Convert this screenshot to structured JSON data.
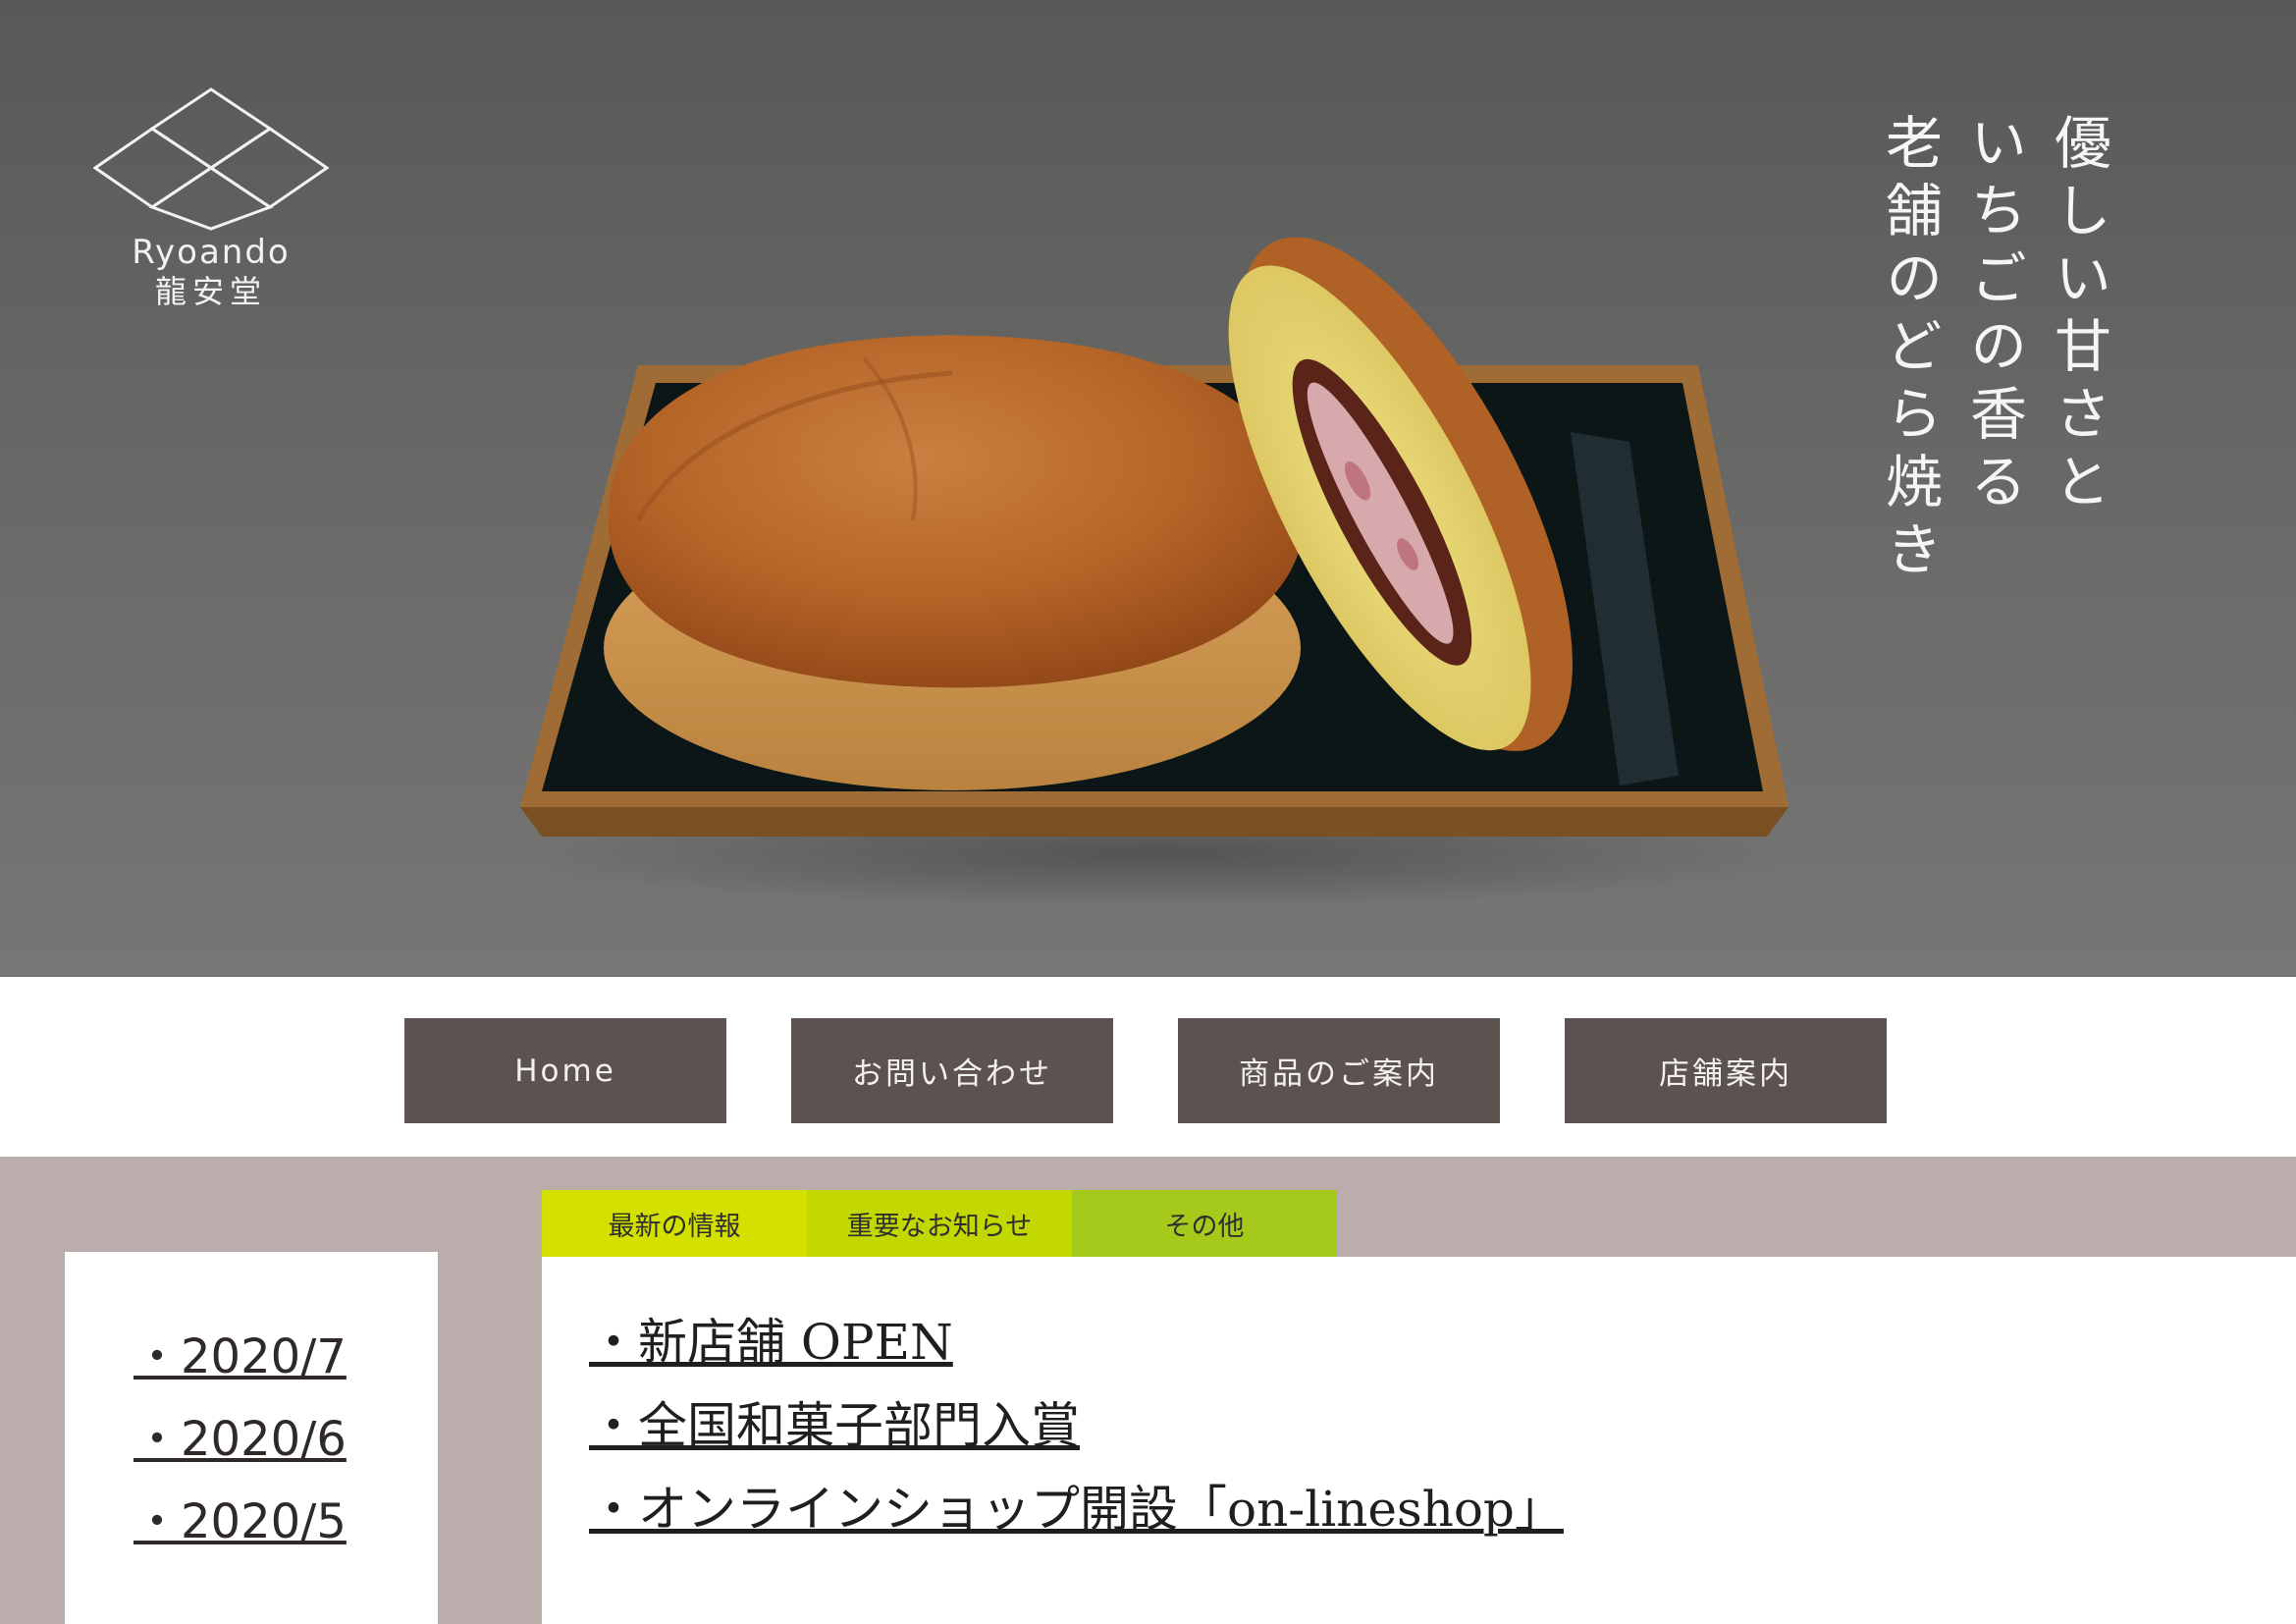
{
  "brand": {
    "name_en": "Ryoando",
    "name_ja": "龍安堂"
  },
  "hero": {
    "tagline_lines": [
      "優しい甘さと",
      "いちごの香る",
      "老舗のどら焼き"
    ],
    "image": "strawberry-dorayaki-on-tray"
  },
  "nav": {
    "items": [
      {
        "label": "Home"
      },
      {
        "label": "お問い合わせ"
      },
      {
        "label": "商品のご案内"
      },
      {
        "label": "店舗案内"
      }
    ]
  },
  "sidebar": {
    "archives": [
      "・2020/7",
      "・2020/6",
      "・2020/5"
    ]
  },
  "tabs": [
    {
      "label": "最新の情報",
      "color": "#d4e000"
    },
    {
      "label": "重要なお知らせ",
      "color": "#c2d800"
    },
    {
      "label": "その他",
      "color": "#a6ca1c"
    }
  ],
  "news": {
    "items": [
      "・新店舗 OPEN",
      "・全国和菓子部門入賞",
      "・オンラインショップ開設「on-lineshop」"
    ]
  },
  "colors": {
    "nav_button": "#5c5250",
    "content_background": "#bbadab",
    "hero_background": "#676766"
  }
}
